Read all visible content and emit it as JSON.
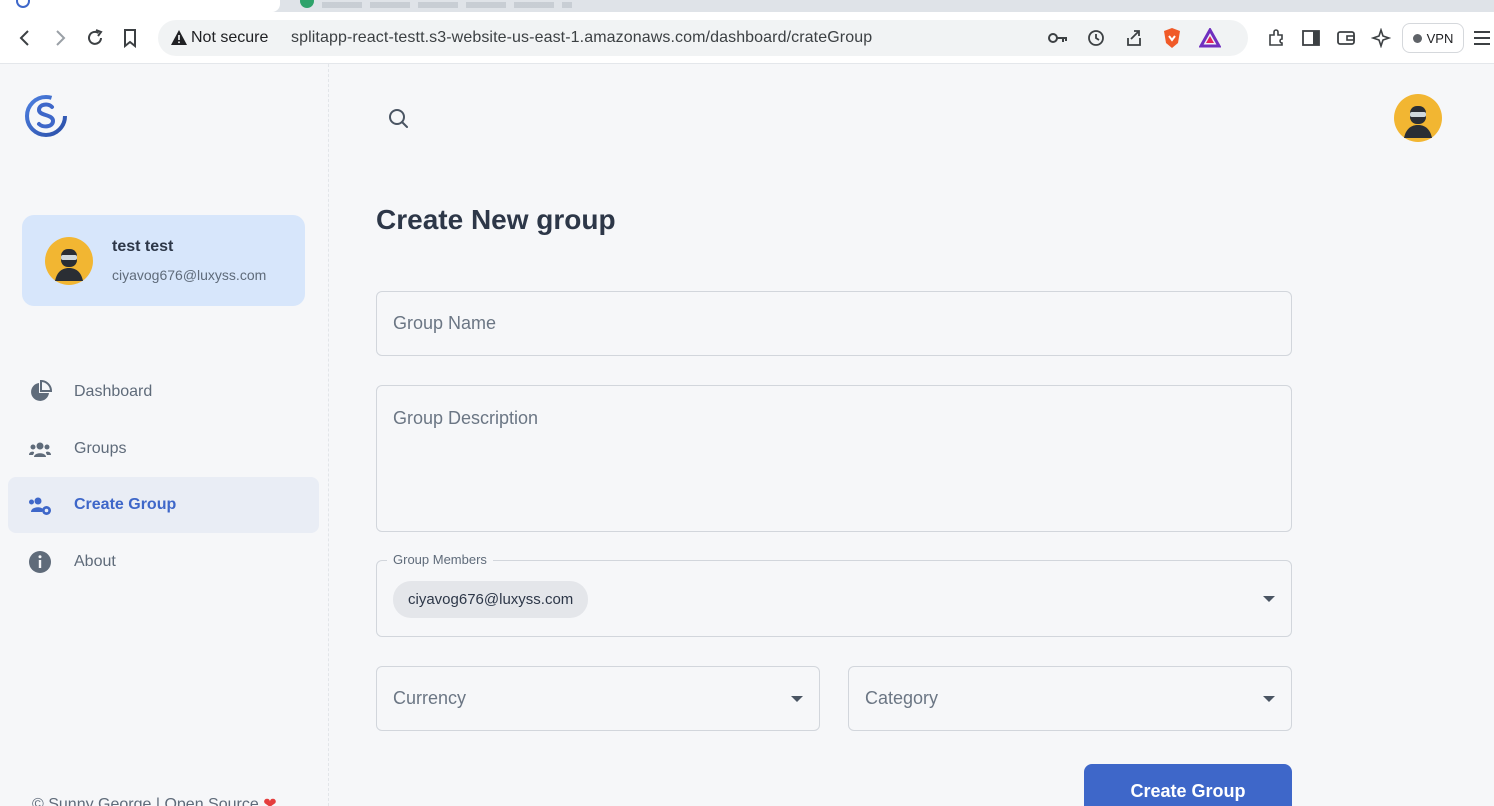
{
  "browser": {
    "security_label": "Not secure",
    "url": "splitapp-react-testt.s3-website-us-east-1.amazonaws.com/dashboard/crateGroup",
    "vpn_label": "VPN"
  },
  "sidebar": {
    "user": {
      "name": "test test",
      "email": "ciyavog676@luxyss.com"
    },
    "items": [
      {
        "label": "Dashboard",
        "icon": "pie-chart-icon",
        "active": false
      },
      {
        "label": "Groups",
        "icon": "people-icon",
        "active": false
      },
      {
        "label": "Create Group",
        "icon": "people-gear-icon",
        "active": true
      },
      {
        "label": "About",
        "icon": "info-icon",
        "active": false
      }
    ],
    "footer": "© Sunny George | Open Source"
  },
  "main": {
    "title": "Create New group",
    "group_name_placeholder": "Group Name",
    "group_description_placeholder": "Group Description",
    "members_label": "Group Members",
    "members": [
      "ciyavog676@luxyss.com"
    ],
    "currency_placeholder": "Currency",
    "category_placeholder": "Category",
    "submit_label": "Create Group"
  },
  "colors": {
    "accent": "#3e67c9",
    "user_card_bg": "#d7e6fb",
    "active_nav_bg": "#e9edf5",
    "page_bg": "#f6f7f9"
  }
}
